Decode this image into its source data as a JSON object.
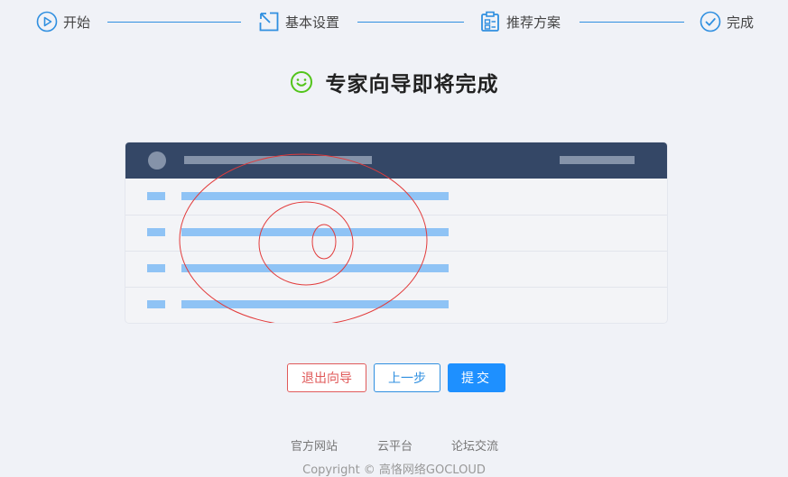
{
  "steps": [
    {
      "label": "开始",
      "icon": "play-circle-icon"
    },
    {
      "label": "基本设置",
      "icon": "cursor-box-icon"
    },
    {
      "label": "推荐方案",
      "icon": "clipboard-icon"
    },
    {
      "label": "完成",
      "icon": "check-circle-icon"
    }
  ],
  "title": "专家向导即将完成",
  "title_icon": "smile-icon",
  "buttons": {
    "exit": "退出向导",
    "prev": "上一步",
    "submit": "提交"
  },
  "footer": {
    "links": [
      "官方网站",
      "云平台",
      "论坛交流"
    ],
    "copyright": "Copyright © 高恪网络GOCLOUD"
  },
  "colors": {
    "accent": "#1e90ff",
    "danger": "#e05a5a",
    "header": "#344766",
    "placeholder": "#8fc3f5"
  }
}
